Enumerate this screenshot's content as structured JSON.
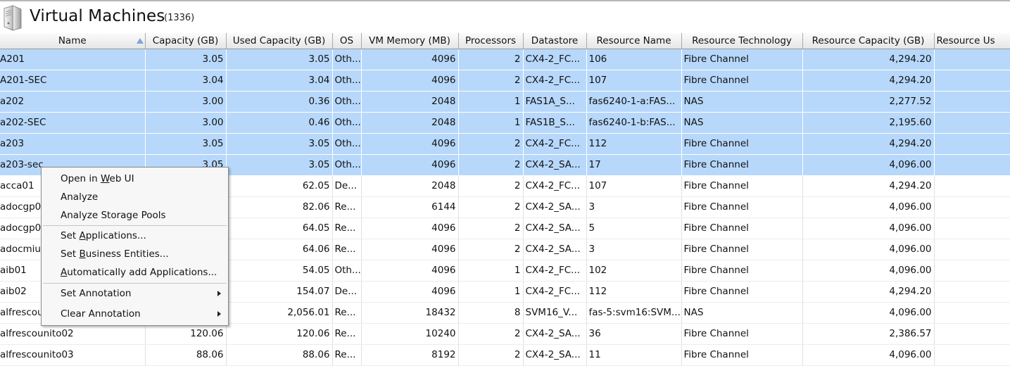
{
  "header": {
    "title": "Virtual Machines",
    "count": "(1336)",
    "icon": "server-icon"
  },
  "columns": [
    "Name",
    "Capacity (GB)",
    "Used Capacity (GB)",
    "OS",
    "VM Memory (MB)",
    "Processors",
    "Datastore",
    "Resource Name",
    "Resource Technology",
    "Resource Capacity (GB)",
    "Resource Us"
  ],
  "rows": [
    {
      "name": "A201",
      "capacity": "3.05",
      "used": "3.05",
      "os": "Oth...",
      "mem": "4096",
      "proc": "2",
      "ds": "CX4-2_FC...",
      "rname": "106",
      "rtech": "Fibre Channel",
      "rcap": "4,294.20",
      "selected": true
    },
    {
      "name": "A201-SEC",
      "capacity": "3.04",
      "used": "3.04",
      "os": "Oth...",
      "mem": "4096",
      "proc": "2",
      "ds": "CX4-2_FC...",
      "rname": "107",
      "rtech": "Fibre Channel",
      "rcap": "4,294.20",
      "selected": true
    },
    {
      "name": "a202",
      "capacity": "3.00",
      "used": "0.36",
      "os": "Oth...",
      "mem": "2048",
      "proc": "1",
      "ds": "FAS1A_S...",
      "rname": "fas6240-1-a:FAS...",
      "rtech": "NAS",
      "rcap": "2,277.52",
      "selected": true
    },
    {
      "name": "a202-SEC",
      "capacity": "3.00",
      "used": "0.46",
      "os": "Oth...",
      "mem": "2048",
      "proc": "1",
      "ds": "FAS1B_S...",
      "rname": "fas6240-1-b:FAS...",
      "rtech": "NAS",
      "rcap": "2,195.60",
      "selected": true
    },
    {
      "name": "a203",
      "capacity": "3.05",
      "used": "3.05",
      "os": "Oth...",
      "mem": "4096",
      "proc": "2",
      "ds": "CX4-2_FC...",
      "rname": "112",
      "rtech": "Fibre Channel",
      "rcap": "4,294.20",
      "selected": true
    },
    {
      "name": "a203-sec",
      "capacity": "3.05",
      "used": "3.05",
      "os": "Oth...",
      "mem": "4096",
      "proc": "2",
      "ds": "CX4-2_SA...",
      "rname": "17",
      "rtech": "Fibre Channel",
      "rcap": "4,096.00",
      "selected": true
    },
    {
      "name": "acca01",
      "capacity": "",
      "used": "62.05",
      "os": "De...",
      "mem": "2048",
      "proc": "2",
      "ds": "CX4-2_FC...",
      "rname": "107",
      "rtech": "Fibre Channel",
      "rcap": "4,294.20",
      "selected": false
    },
    {
      "name": "adocgp0",
      "capacity": "",
      "used": "82.06",
      "os": "Re...",
      "mem": "6144",
      "proc": "2",
      "ds": "CX4-2_SA...",
      "rname": "3",
      "rtech": "Fibre Channel",
      "rcap": "4,096.00",
      "selected": false
    },
    {
      "name": "adocgp0",
      "capacity": "",
      "used": "64.05",
      "os": "Re...",
      "mem": "4096",
      "proc": "2",
      "ds": "CX4-2_SA...",
      "rname": "5",
      "rtech": "Fibre Channel",
      "rcap": "4,096.00",
      "selected": false
    },
    {
      "name": "adocmiu",
      "capacity": "",
      "used": "64.06",
      "os": "Re...",
      "mem": "4096",
      "proc": "2",
      "ds": "CX4-2_SA...",
      "rname": "3",
      "rtech": "Fibre Channel",
      "rcap": "4,096.00",
      "selected": false
    },
    {
      "name": "aib01",
      "capacity": "",
      "used": "54.05",
      "os": "Oth...",
      "mem": "4096",
      "proc": "1",
      "ds": "CX4-2_FC...",
      "rname": "102",
      "rtech": "Fibre Channel",
      "rcap": "4,096.00",
      "selected": false
    },
    {
      "name": "aib02",
      "capacity": "",
      "used": "154.07",
      "os": "De...",
      "mem": "4096",
      "proc": "1",
      "ds": "CX4-2_FC...",
      "rname": "112",
      "rtech": "Fibre Channel",
      "rcap": "4,294.20",
      "selected": false
    },
    {
      "name": "alfrescou",
      "capacity": "",
      "used": "2,056.01",
      "os": "Re...",
      "mem": "18432",
      "proc": "8",
      "ds": "SVM16_V...",
      "rname": "fas-5:svm16:SVM...",
      "rtech": "NAS",
      "rcap": "4,096.00",
      "selected": false
    },
    {
      "name": "alfrescounito02",
      "capacity": "120.06",
      "used": "120.06",
      "os": "Re...",
      "mem": "10240",
      "proc": "2",
      "ds": "CX4-2_SA...",
      "rname": "36",
      "rtech": "Fibre Channel",
      "rcap": "2,386.57",
      "selected": false
    },
    {
      "name": "alfrescounito03",
      "capacity": "88.06",
      "used": "88.06",
      "os": "Re...",
      "mem": "8192",
      "proc": "2",
      "ds": "CX4-2_SA...",
      "rname": "11",
      "rtech": "Fibre Channel",
      "rcap": "4,096.00",
      "selected": false
    }
  ],
  "context_menu": {
    "open_web_ui": {
      "pre": "Open in ",
      "u": "W",
      "post": "eb UI"
    },
    "analyze": "Analyze",
    "analyze_pools": "Analyze Storage Pools",
    "set_applications": {
      "pre": "Set ",
      "u": "A",
      "post": "pplications..."
    },
    "set_business": {
      "pre": "Set ",
      "u": "B",
      "post": "usiness Entities..."
    },
    "auto_add": {
      "pre": "",
      "u": "A",
      "post": "utomatically add Applications..."
    },
    "set_annotation": "Set Annotation",
    "clear_annotation": "Clear Annotation"
  }
}
